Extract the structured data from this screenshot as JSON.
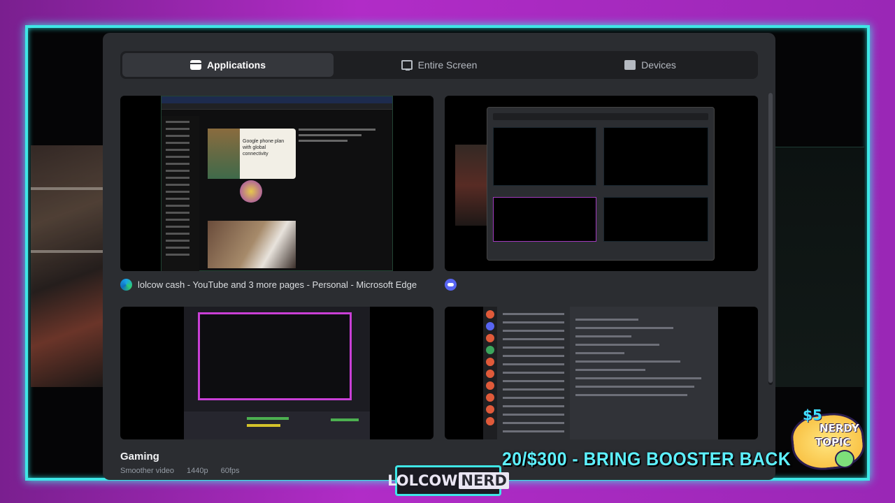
{
  "picker": {
    "tabs": [
      {
        "label": "Applications",
        "active": true,
        "icon": "applications-icon"
      },
      {
        "label": "Entire Screen",
        "active": false,
        "icon": "monitor-icon"
      },
      {
        "label": "Devices",
        "active": false,
        "icon": "camera-icon"
      }
    ],
    "windows": [
      {
        "title": "lolcow cash - YouTube and 3 more pages - Personal - Microsoft Edge",
        "app_icon": "edge-icon"
      },
      {
        "title": "",
        "app_icon": "discord-icon"
      },
      {
        "title": "",
        "app_icon": ""
      },
      {
        "title": "",
        "app_icon": ""
      }
    ],
    "browser_thumb": {
      "ad_text": "Google phone plan with global connectivity"
    },
    "gaming": {
      "title": "Gaming",
      "details": [
        "Smoother video",
        "1440p",
        "60fps"
      ]
    }
  },
  "overlay": {
    "goal_text": "20/$300 - BRING BOOSTER BACK",
    "logo_left": "LOLCOW",
    "logo_right": "NERD",
    "badge_price": "$5",
    "badge_word1": "NERDY",
    "badge_word2": "TOPIC"
  },
  "colors": {
    "frame_cyan": "#3fe6e6",
    "frame_purple": "#b12cc7",
    "discord_panel": "#2b2d31",
    "goal_text": "#5df0ff"
  }
}
